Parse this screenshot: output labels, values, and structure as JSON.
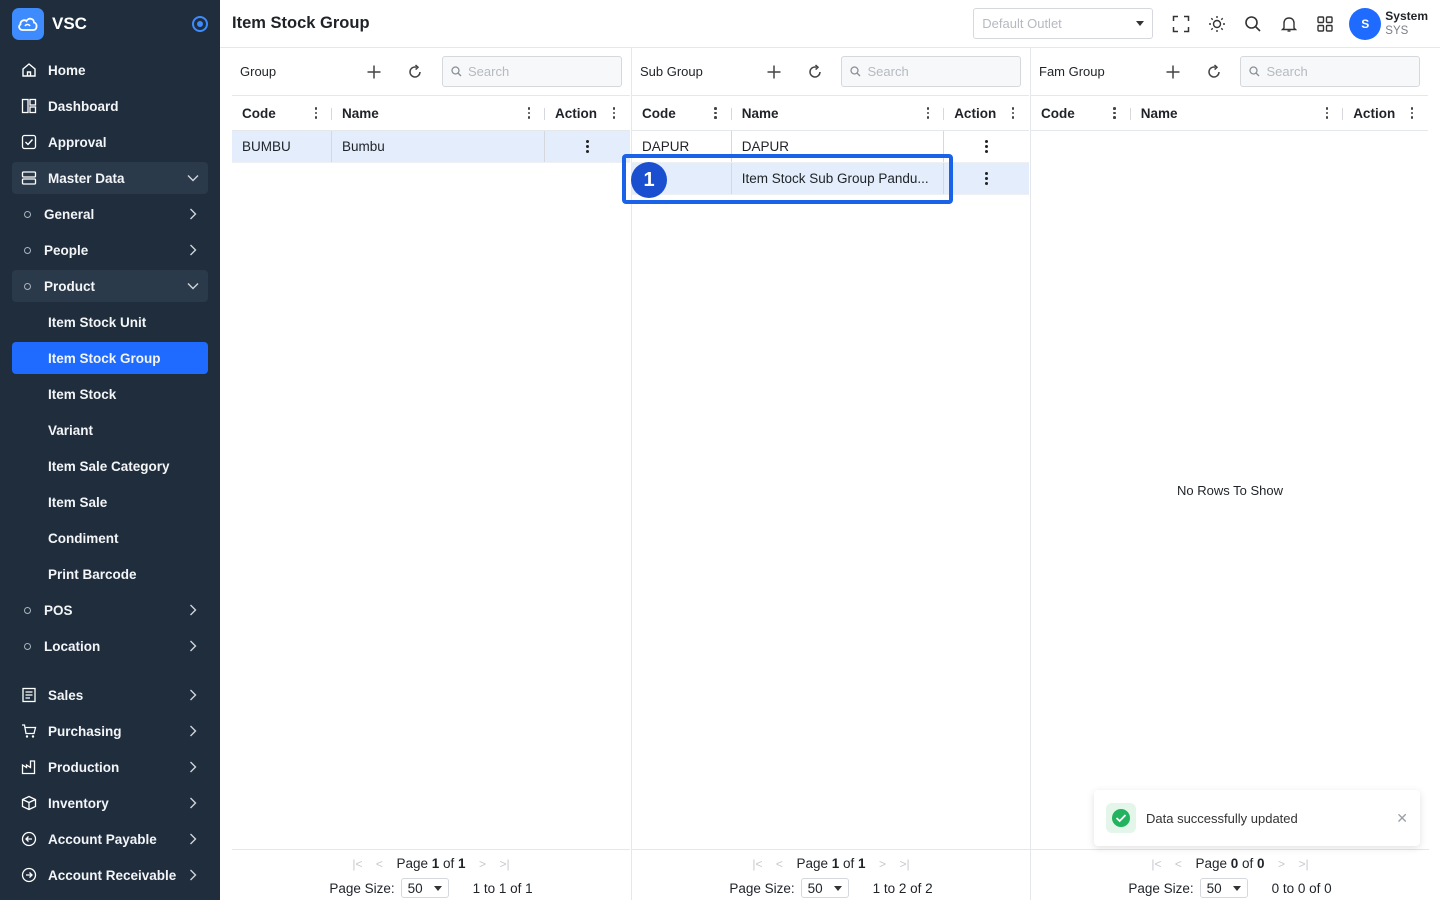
{
  "app": {
    "name": "VSC"
  },
  "colors": {
    "sidebar": "#1f2d3d",
    "accent": "#1f6bff",
    "selected_row": "#e3edfb",
    "success": "#22b35e"
  },
  "sidebar": {
    "items": [
      {
        "label": "Home",
        "icon": "home-icon"
      },
      {
        "label": "Dashboard",
        "icon": "dashboard-icon"
      },
      {
        "label": "Approval",
        "icon": "checkbox-icon"
      },
      {
        "label": "Master Data",
        "icon": "database-icon"
      },
      {
        "label": "General"
      },
      {
        "label": "People"
      },
      {
        "label": "Product"
      },
      {
        "label": "Item Stock Unit"
      },
      {
        "label": "Item Stock Group"
      },
      {
        "label": "Item Stock"
      },
      {
        "label": "Variant"
      },
      {
        "label": "Item Sale Category"
      },
      {
        "label": "Item Sale"
      },
      {
        "label": "Condiment"
      },
      {
        "label": "Print Barcode"
      },
      {
        "label": "POS"
      },
      {
        "label": "Location"
      },
      {
        "label": "Sales",
        "icon": "receipt-icon"
      },
      {
        "label": "Purchasing",
        "icon": "cart-icon"
      },
      {
        "label": "Production",
        "icon": "factory-icon"
      },
      {
        "label": "Inventory",
        "icon": "box-icon"
      },
      {
        "label": "Account Payable",
        "icon": "arrow-left-circle-icon"
      },
      {
        "label": "Account Receivable",
        "icon": "arrow-right-circle-icon"
      }
    ]
  },
  "header": {
    "title": "Item Stock Group",
    "outlet_placeholder": "Default Outlet",
    "user": {
      "initial": "S",
      "name": "System",
      "code": "SYS"
    }
  },
  "panels": [
    {
      "title": "Group",
      "search_placeholder": "Search",
      "columns": [
        "Code",
        "Name",
        "Action"
      ],
      "rows": [
        {
          "code": "BUMBU",
          "name": "Bumbu"
        }
      ],
      "pager": {
        "page_label": "Page",
        "page": "1",
        "of_label": "of",
        "total_pages": "1",
        "size_label": "Page Size:",
        "size": "50",
        "range": "1 to 1 of 1"
      }
    },
    {
      "title": "Sub Group",
      "search_placeholder": "Search",
      "columns": [
        "Code",
        "Name",
        "Action"
      ],
      "rows": [
        {
          "code": "DAPUR",
          "name": "DAPUR"
        },
        {
          "code": "",
          "name": "Item Stock Sub Group Pandu..."
        }
      ],
      "pager": {
        "page_label": "Page",
        "page": "1",
        "of_label": "of",
        "total_pages": "1",
        "size_label": "Page Size:",
        "size": "50",
        "range": "1 to 2 of 2"
      }
    },
    {
      "title": "Fam Group",
      "search_placeholder": "Search",
      "columns": [
        "Code",
        "Name",
        "Action"
      ],
      "rows": [],
      "empty_text": "No Rows To Show",
      "pager": {
        "page_label": "Page",
        "page": "0",
        "of_label": "of",
        "total_pages": "0",
        "size_label": "Page Size:",
        "size": "50",
        "range": "0 to 0 of 0"
      }
    }
  ],
  "annotation": {
    "label": "1"
  },
  "toast": {
    "message": "Data successfully updated"
  }
}
